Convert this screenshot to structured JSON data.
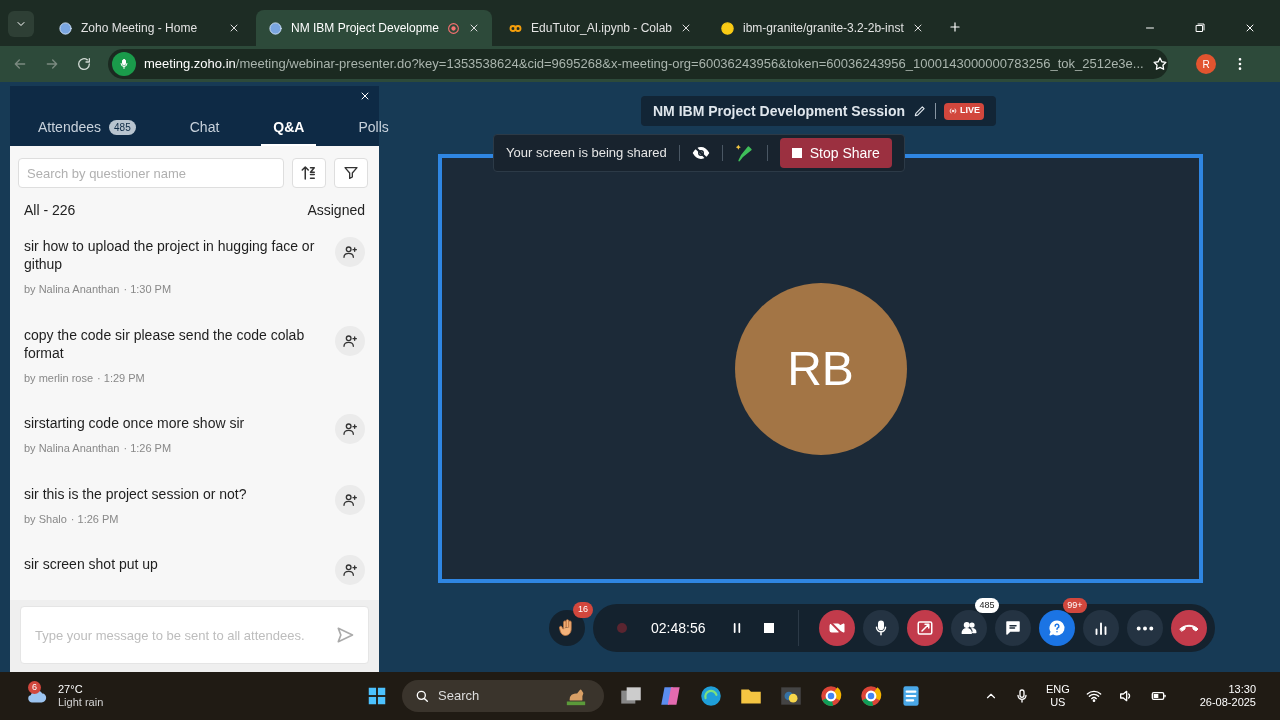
{
  "browser": {
    "tabs": [
      {
        "title": "Zoho Meeting - Home",
        "selected": false,
        "recording": false
      },
      {
        "title": "NM IBM Project Developme",
        "selected": true,
        "recording": true
      },
      {
        "title": "EduTutor_AI.ipynb - Colab",
        "selected": false,
        "recording": false
      },
      {
        "title": "ibm-granite/granite-3.2-2b-inst",
        "selected": false,
        "recording": false
      }
    ],
    "url_host": "meeting.zoho.in",
    "url_rest": "/meeting/webinar-presenter.do?key=1353538624&cid=9695268&x-meeting-org=60036243956&token=60036243956_1000143000000783256_tok_2512e3e...",
    "profile": "R"
  },
  "panel": {
    "tabs": [
      {
        "label": "Attendees",
        "count": "485",
        "selected": false
      },
      {
        "label": "Chat",
        "selected": false
      },
      {
        "label": "Q&A",
        "selected": true
      },
      {
        "label": "Polls",
        "selected": false
      }
    ],
    "search": {
      "placeholder": "Search by questioner name"
    },
    "filter_label": "All - 226",
    "assigned_label": "Assigned",
    "questions": [
      {
        "text": "sir how to upload the project in hugging face or githup",
        "author": "by Nalina Ananthan",
        "time": "· 1:30 PM"
      },
      {
        "text": "copy the code sir please send the code colab format",
        "author": "by merlin rose",
        "time": "· 1:29 PM"
      },
      {
        "text": "sirstarting code once more show sir",
        "author": "by Nalina Ananthan",
        "time": "· 1:26 PM"
      },
      {
        "text": "sir this is the project session or not?",
        "author": "by Shalo",
        "time": "· 1:26 PM"
      },
      {
        "text": "sir screen shot put up"
      }
    ],
    "message": {
      "placeholder": "Type your message to be sent to all attendees."
    }
  },
  "session": {
    "title": "NM IBM Project Development Session",
    "live": "LIVE"
  },
  "share_bar": {
    "text": "Your screen is being shared",
    "stop": "Stop Share"
  },
  "presenter": {
    "initials": "RB"
  },
  "controls": {
    "hand_count": "16",
    "timer": "02:48:56",
    "buttons": [
      {
        "kind": "video",
        "danger": true
      },
      {
        "kind": "mic",
        "danger": false
      },
      {
        "kind": "share",
        "danger": true
      },
      {
        "kind": "people",
        "danger": false,
        "badge": "485"
      },
      {
        "kind": "chat",
        "danger": false
      },
      {
        "kind": "qa",
        "danger": false,
        "badge": "99+"
      },
      {
        "kind": "polls",
        "danger": false
      },
      {
        "kind": "more",
        "danger": false
      },
      {
        "kind": "end",
        "danger": true
      }
    ]
  },
  "taskbar": {
    "weather_badge": "6",
    "temp": "27°C",
    "weather": "Light rain",
    "search": "Search",
    "lang": "ENG",
    "region": "US",
    "time": "13:30",
    "date": "26-08-2025"
  }
}
